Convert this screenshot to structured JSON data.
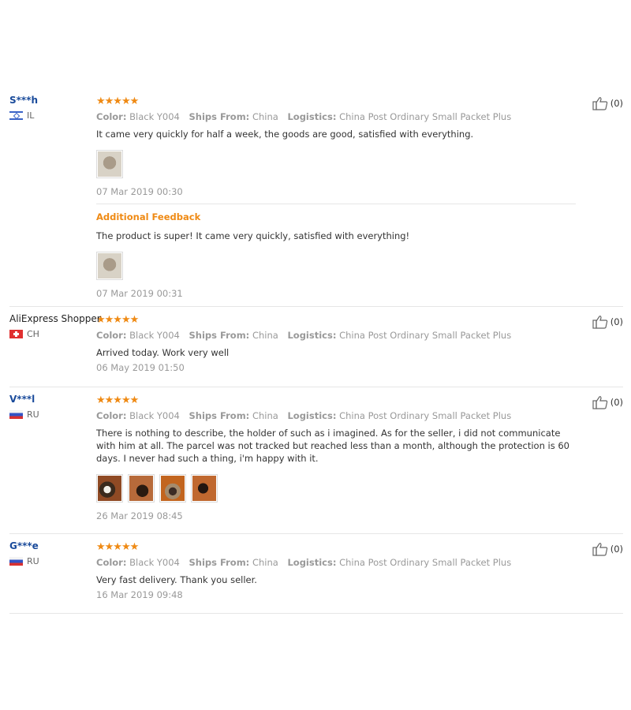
{
  "labels": {
    "color": "Color:",
    "ships_from": "Ships From:",
    "logistics": "Logistics:",
    "additional_feedback": "Additional Feedback"
  },
  "colors": {
    "star": "#ef8a14",
    "username": "#1a4b9b",
    "muted": "#999999"
  },
  "reviews": [
    {
      "user": "S***h",
      "country": "IL",
      "flag_icon": "israel-flag-icon",
      "rating": 5,
      "stars": "★★★★★",
      "color": "Black Y004",
      "ships_from": "China",
      "logistics": "China Post Ordinary Small Packet Plus",
      "text": "It came very quickly for half a week, the goods are good, satisfied with everything.",
      "photo_count": 1,
      "date": "07 Mar 2019 00:30",
      "helpful": "(0)",
      "feedback": {
        "text": "The product is super! It came very quickly, satisfied with everything!",
        "photo_count": 1,
        "date": "07 Mar 2019 00:31"
      }
    },
    {
      "user": "AliExpress Shopper",
      "country": "CH",
      "flag_icon": "switzerland-flag-icon",
      "rating": 5,
      "stars": "★★★★★",
      "color": "Black Y004",
      "ships_from": "China",
      "logistics": "China Post Ordinary Small Packet Plus",
      "text": "Arrived today. Work very well",
      "date": "06 May 2019 01:50",
      "helpful": "(0)"
    },
    {
      "user": "V***l",
      "country": "RU",
      "flag_icon": "russia-flag-icon",
      "rating": 5,
      "stars": "★★★★★",
      "color": "Black Y004",
      "ships_from": "China",
      "logistics": "China Post Ordinary Small Packet Plus",
      "text": "There is nothing to describe, the holder of such as i imagined. As for the seller, i did not communicate with him at all. The parcel was not tracked but reached less than a month, although the protection is 60 days. I never had such a thing, i'm happy with it.",
      "photo_count": 4,
      "date": "26 Mar 2019 08:45",
      "helpful": "(0)"
    },
    {
      "user": "G***e",
      "country": "RU",
      "flag_icon": "russia-flag-icon",
      "rating": 5,
      "stars": "★★★★★",
      "color": "Black Y004",
      "ships_from": "China",
      "logistics": "China Post Ordinary Small Packet Plus",
      "text": "Very fast delivery. Thank you seller.",
      "date": "16 Mar 2019 09:48",
      "helpful": "(0)"
    }
  ]
}
